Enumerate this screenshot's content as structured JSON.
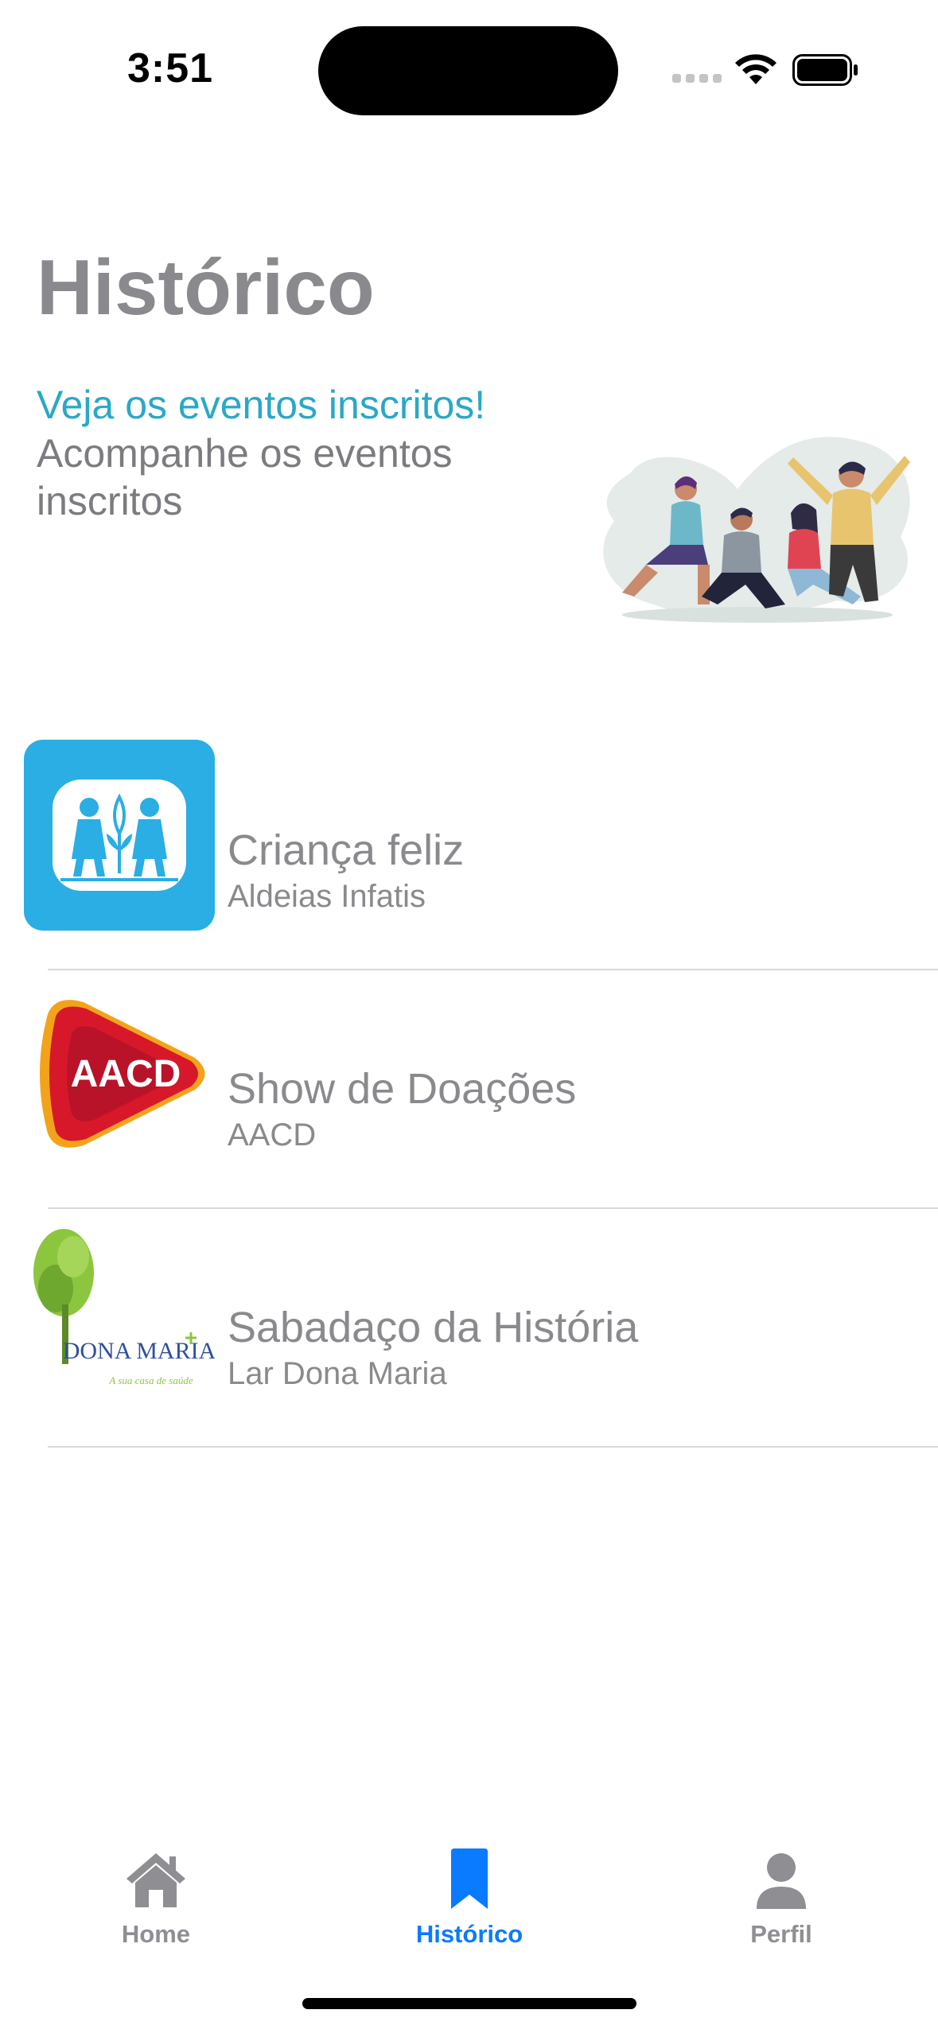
{
  "status_bar": {
    "time": "3:51"
  },
  "header": {
    "title": "Histórico",
    "accent_line": "Veja os eventos inscritos!",
    "description": "Acompanhe os eventos inscritos"
  },
  "events": [
    {
      "title": "Criança feliz",
      "organization": "Aldeias Infatis",
      "logo": "aldeias-infantis-logo"
    },
    {
      "title": "Show de Doações",
      "organization": "AACD",
      "logo": "aacd-logo",
      "logo_text": "AACD"
    },
    {
      "title": "Sabadaço da História",
      "organization": "Lar Dona Maria",
      "logo": "dona-maria-logo",
      "logo_text": "DONA MARIA",
      "logo_tagline": "A sua casa de saúde"
    }
  ],
  "tab_bar": {
    "tabs": [
      {
        "label": "Home",
        "icon": "house-icon",
        "active": false
      },
      {
        "label": "Histórico",
        "icon": "bookmark-icon",
        "active": true
      },
      {
        "label": "Perfil",
        "icon": "person-icon",
        "active": false
      }
    ]
  },
  "colors": {
    "accent": "#2aa8c7",
    "active_tab": "#0a7aff",
    "inactive_text": "#8e8e93",
    "aldeias_blue": "#2aaee3",
    "aacd_red": "#d7182a"
  }
}
